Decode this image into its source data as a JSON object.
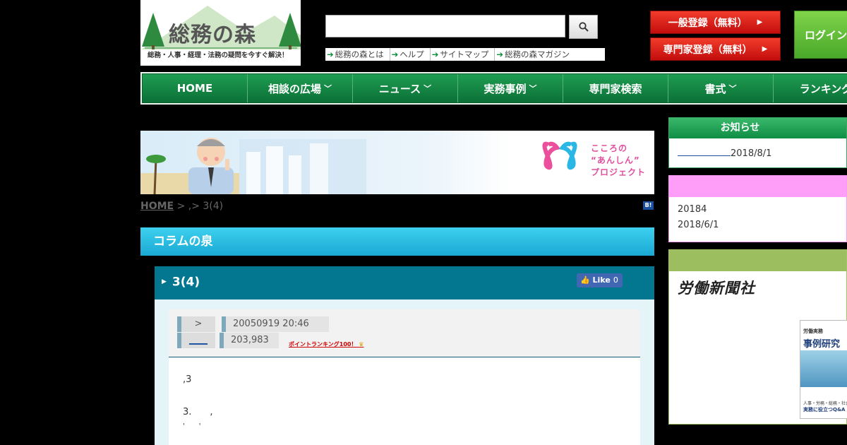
{
  "logo": {
    "title": "総務の森",
    "subtitle": "総務・人事・経理・法務の疑問を今すぐ解決！"
  },
  "search": {
    "value": "",
    "placeholder": "",
    "icon": "search-icon"
  },
  "sublinks": [
    "総務の森とは",
    "ヘルプ",
    "サイトマップ",
    "総務の森マガジン"
  ],
  "header_buttons": {
    "general_register": "一般登録（無料）",
    "expert_register": "専門家登録（無料）",
    "login": "ログイン"
  },
  "nav": [
    {
      "label": "HOME",
      "dropdown": false
    },
    {
      "label": "相談の広場",
      "dropdown": true
    },
    {
      "label": "ニュース",
      "dropdown": true
    },
    {
      "label": "実務事例",
      "dropdown": true
    },
    {
      "label": "専門家検索",
      "dropdown": false
    },
    {
      "label": "書式",
      "dropdown": true
    },
    {
      "label": "ランキング",
      "dropdown": false
    }
  ],
  "banner": {
    "line1": "こころの",
    "line2": "“あんしん”",
    "line3": "プロジェクト"
  },
  "breadcrumb": {
    "home": "HOME",
    "rest": " > ,> 3(4)"
  },
  "bookmark_badge": "B!",
  "section_title": "コラムの泉",
  "article": {
    "title": "3(4)",
    "like_label": "Like",
    "like_count": "0",
    "category": ">",
    "datetime": "20050919 20:46",
    "author": "____",
    "views": "203,983",
    "point_ranking": "ポイントランキング100！",
    "body": [
      ",3",
      "3.　　,",
      "'　　'"
    ]
  },
  "sidebar": {
    "notice_title": "お知らせ",
    "notice_date": "2018/8/1",
    "pink_lines": [
      "20184",
      "2018/6/1"
    ],
    "publisher": "労働新聞社",
    "book": {
      "series": "労働実務",
      "title": "事例研究",
      "caption": "人事・労務・総務・社会保",
      "tagline": "実務に役立つQ&A"
    }
  }
}
